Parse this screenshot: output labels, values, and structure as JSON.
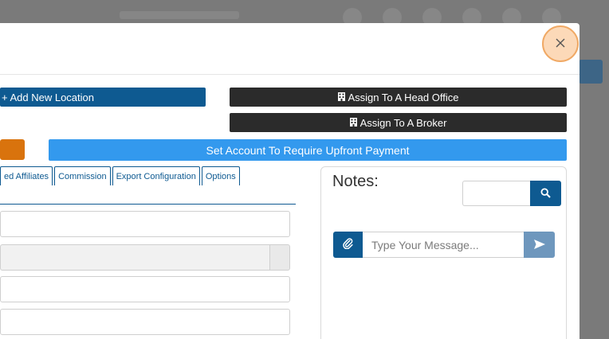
{
  "buttons": {
    "add_location": "+ Add New Location",
    "assign_head_office": "Assign To A Head Office",
    "assign_broker": "Assign To A Broker",
    "upfront_payment": "Set Account To Require Upfront Payment"
  },
  "tabs": [
    {
      "label": "ed Affiliates"
    },
    {
      "label": "Commission"
    },
    {
      "label": "Export Configuration"
    },
    {
      "label": "Options"
    }
  ],
  "notes": {
    "title": "Notes:",
    "message_placeholder": "Type Your Message..."
  },
  "icons": {
    "close": "close-icon",
    "building": "building-icon",
    "search": "search-icon",
    "attach": "paperclip-icon",
    "send": "send-icon"
  },
  "colors": {
    "primary": "#0e5a91",
    "dark": "#2b2b2b",
    "light_blue": "#3399ee",
    "orange": "#d9730d",
    "close_bg": "#fcd9b8",
    "send_bg": "#6e97bd"
  }
}
